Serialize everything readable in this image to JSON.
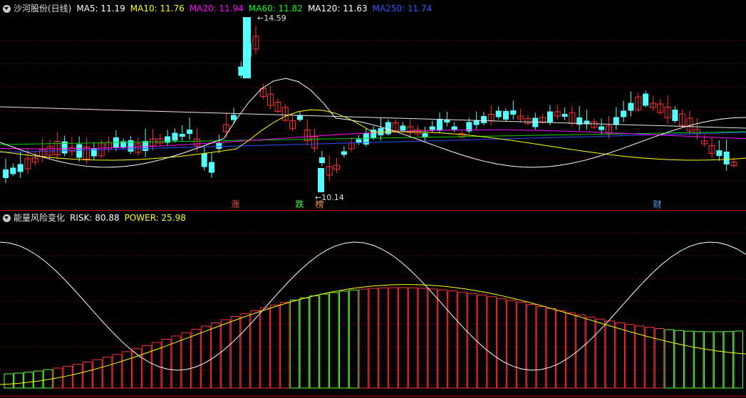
{
  "main_panel": {
    "title": "沙河股份(日线)",
    "indicators": [
      {
        "label": "MA5: 11.19",
        "color": "#ffffff"
      },
      {
        "label": "MA10: 11.76",
        "color": "#ffff00"
      },
      {
        "label": "MA20: 11.94",
        "color": "#ff00ff"
      },
      {
        "label": "MA60: 11.82",
        "color": "#00ff00"
      },
      {
        "label": "MA120: 11.63",
        "color": "#ffffff"
      },
      {
        "label": "MA250: 11.74",
        "color": "#2040ff"
      }
    ],
    "high_label": "14.59",
    "low_label": "10.14",
    "event_badges": [
      {
        "text": "涨",
        "color": "#ff5050",
        "bg": "#3a0000"
      },
      {
        "text": "跌",
        "color": "#40ff40",
        "bg": "#003000"
      },
      {
        "text": "榜",
        "color": "#ffa040",
        "bg": "#3a2000"
      },
      {
        "text": "财",
        "color": "#60a0ff",
        "bg": "#00183a"
      }
    ]
  },
  "sub_panel": {
    "title": "能量风险变化",
    "risk_label": "RISK: 80.88",
    "power_label": "POWER: 25.98"
  },
  "colors": {
    "background": "#000000",
    "up": "#ff3232",
    "down": "#54ffff",
    "grid": "#8b0000",
    "border": "#b40000"
  }
}
